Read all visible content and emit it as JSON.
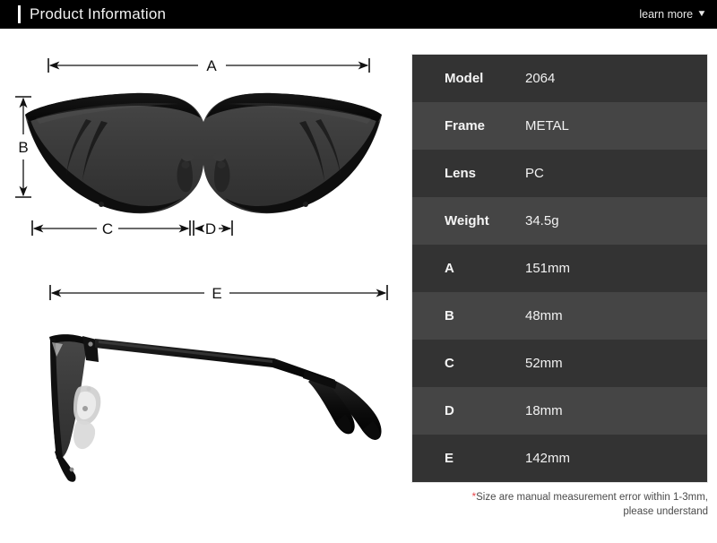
{
  "header": {
    "title": "Product Information",
    "learn_more": "learn more",
    "caret_icon": "chevron-down-icon",
    "background_color": "#000000",
    "accent_color": "#ffffff"
  },
  "diagram": {
    "front_view": {
      "name": "sunglasses-front-view",
      "description": "Cat-eye sunglasses front view with dark tinted lens and black brow bar",
      "lens_color": "#3a3a3a",
      "frame_color": "#0d0d0d"
    },
    "side_view": {
      "name": "sunglasses-side-view",
      "description": "Sunglasses side profile showing temple arm",
      "lens_color": "#3f3f3f",
      "frame_color": "#0d0d0d"
    },
    "dimension_labels": {
      "a": "A",
      "b": "B",
      "c": "C",
      "d": "D",
      "e": "E"
    },
    "line_color": "#111111"
  },
  "spec_table": {
    "rows": [
      {
        "label": "Model",
        "value": "2064"
      },
      {
        "label": "Frame",
        "value": "METAL"
      },
      {
        "label": "Lens",
        "value": "PC"
      },
      {
        "label": "Weight",
        "value": "34.5g"
      },
      {
        "label": "A",
        "value": "151mm"
      },
      {
        "label": "B",
        "value": "48mm"
      },
      {
        "label": "C",
        "value": "52mm"
      },
      {
        "label": "D",
        "value": "18mm"
      },
      {
        "label": "E",
        "value": "142mm"
      }
    ],
    "row_color_odd": "#333333",
    "row_color_even": "#454545",
    "text_color": "#f2f2f2"
  },
  "footnote": {
    "star": "*",
    "line1": "Size are manual measurement error within 1-3mm,",
    "line2": "please understand",
    "star_color": "#e8484d",
    "text_color": "#4a4a4a"
  }
}
